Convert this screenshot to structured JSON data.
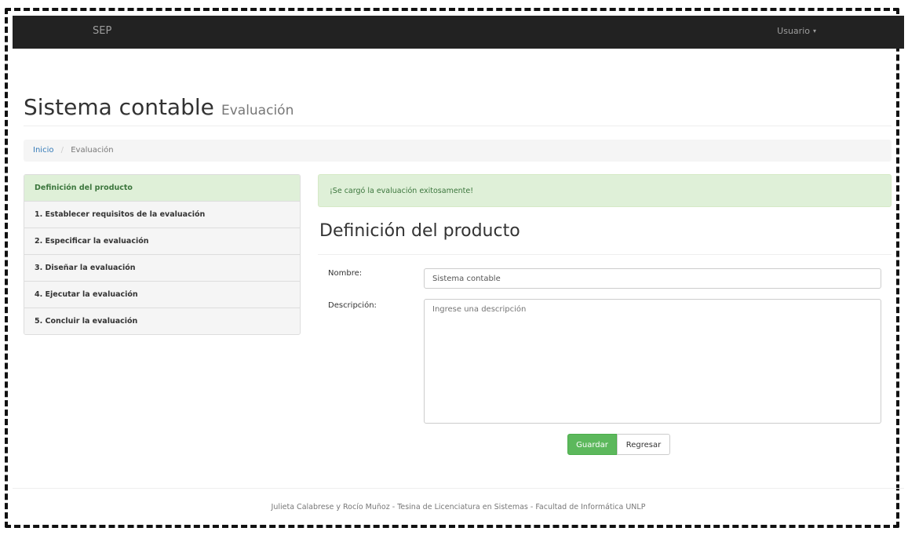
{
  "navbar": {
    "brand": "SEP",
    "user_menu": "Usuario",
    "caret": "▾"
  },
  "header": {
    "title": "Sistema contable",
    "subtitle": "Evaluación"
  },
  "breadcrumb": {
    "home": "Inicio",
    "separator": "/",
    "current": "Evaluación"
  },
  "sidebar": {
    "items": [
      {
        "label": "Definición del producto"
      },
      {
        "label": "1. Establecer requisitos de la evaluación"
      },
      {
        "label": "2. Especificar la evaluación"
      },
      {
        "label": "3. Diseñar la evaluación"
      },
      {
        "label": "4. Ejecutar la evaluación"
      },
      {
        "label": "5. Concluir la evaluación"
      }
    ]
  },
  "main": {
    "alert": "¡Se cargó la evaluación exitosamente!",
    "section_title": "Definición del producto",
    "form": {
      "name_label": "Nombre:",
      "name_value": "Sistema contable",
      "description_label": "Descripción:",
      "description_placeholder": "Ingrese una descripción",
      "description_value": ""
    },
    "buttons": {
      "save": "Guardar",
      "back": "Regresar"
    }
  },
  "footer": {
    "text": "Julieta Calabrese y Rocío Muñoz - Tesina de Licenciatura en Sistemas - Facultad de Informática UNLP"
  },
  "colors": {
    "navbar": "#222222",
    "success_bg": "#dff0d8",
    "success_text": "#3c763d",
    "primary_button": "#5cb85c",
    "link": "#337ab7"
  }
}
